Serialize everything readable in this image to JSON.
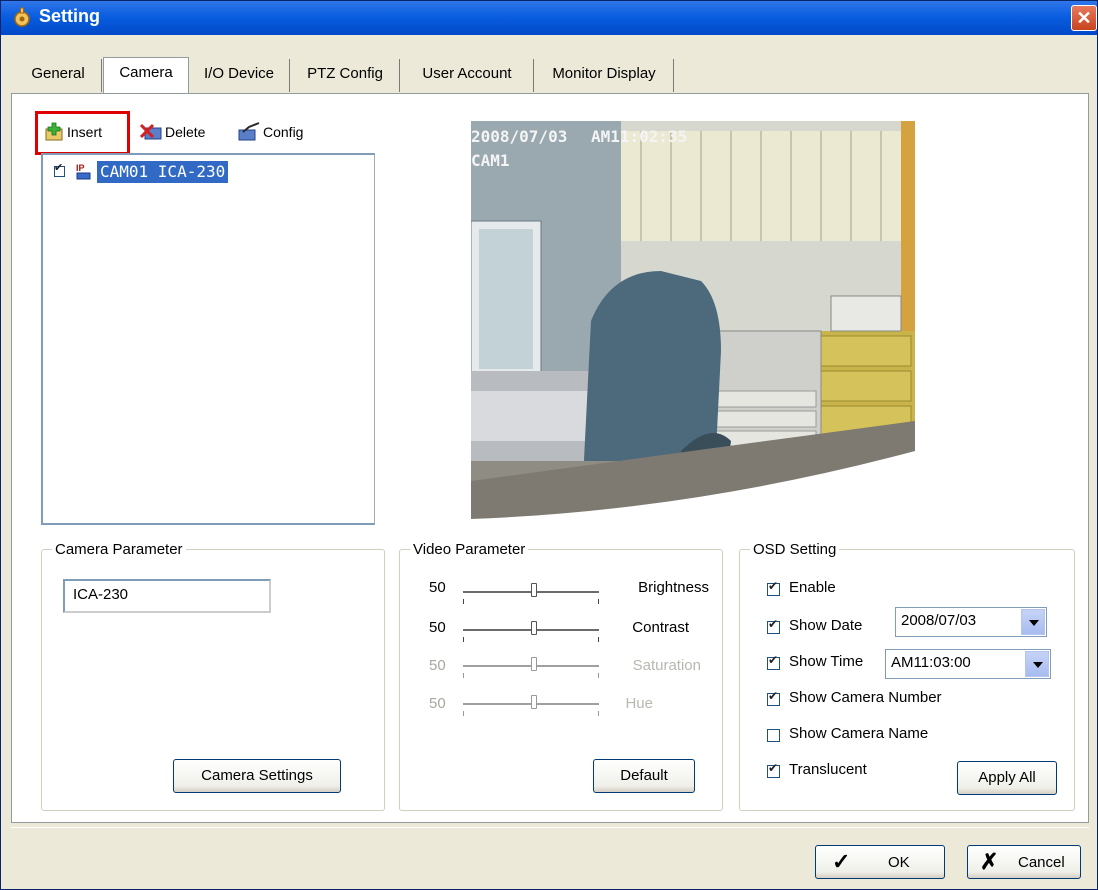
{
  "window": {
    "title": "Setting",
    "close_glyph": "✕"
  },
  "tabs": [
    {
      "label": "General"
    },
    {
      "label": "Camera",
      "active": true
    },
    {
      "label": "I/O Device"
    },
    {
      "label": "PTZ Config"
    },
    {
      "label": "User Account"
    },
    {
      "label": "Monitor Display"
    }
  ],
  "toolbar": {
    "insert": "Insert",
    "delete": "Delete",
    "config": "Config"
  },
  "tree": {
    "items": [
      {
        "label": "CAM01 ICA-230",
        "checked": true,
        "selected": true
      }
    ]
  },
  "video": {
    "osd_date": "2008/07/03",
    "osd_time": "AM11:02:35",
    "osd_cam": "CAM1"
  },
  "camera_parameter": {
    "legend": "Camera Parameter",
    "name_value": "ICA-230",
    "settings_button": "Camera Settings"
  },
  "video_parameter": {
    "legend": "Video Parameter",
    "sliders": [
      {
        "name": "Brightness",
        "value": "50",
        "enabled": true
      },
      {
        "name": "Contrast",
        "value": "50",
        "enabled": true
      },
      {
        "name": "Saturation",
        "value": "50",
        "enabled": false
      },
      {
        "name": "Hue",
        "value": "50",
        "enabled": false
      }
    ],
    "default_button": "Default"
  },
  "osd_setting": {
    "legend": "OSD Setting",
    "enable": {
      "label": "Enable",
      "checked": true
    },
    "show_date": {
      "label": "Show Date",
      "checked": true,
      "value": "2008/07/03"
    },
    "show_time": {
      "label": "Show Time",
      "checked": true,
      "value": "AM11:03:00"
    },
    "show_camera_number": {
      "label": "Show Camera Number",
      "checked": true
    },
    "show_camera_name": {
      "label": "Show Camera Name",
      "checked": false
    },
    "translucent": {
      "label": "Translucent",
      "checked": true
    },
    "apply_all_button": "Apply All"
  },
  "footer": {
    "ok": "OK",
    "cancel": "Cancel"
  },
  "icons": {
    "title": "app-gear-icon",
    "insert": "insert-plus-icon",
    "delete": "delete-x-icon",
    "config": "config-check-icon",
    "ip_camera": "ip-camera-icon",
    "ok": "checkmark-icon",
    "cancel": "x-icon"
  },
  "colors": {
    "title_bar": "#0a5ee0",
    "selection": "#316ac5",
    "highlight_box": "#e00000",
    "dialog_bg": "#ece9d8"
  }
}
